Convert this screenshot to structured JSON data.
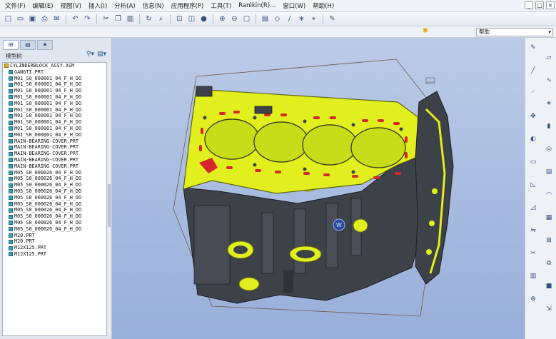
{
  "menubar": {
    "items": [
      "文件(F)",
      "编辑(E)",
      "视图(V)",
      "插入(I)",
      "分析(A)",
      "信息(N)",
      "应用程序(P)",
      "工具(T)",
      "Ranlkin(R)...",
      "窗口(W)",
      "帮助(H)"
    ]
  },
  "window_controls": [
    "_",
    "□",
    "×"
  ],
  "toolbar_icons": [
    "new-icon",
    "open-icon",
    "save-icon",
    "print-icon",
    "email-icon",
    "sep",
    "undo-icon",
    "redo-icon",
    "sep",
    "cut-icon",
    "copy-icon",
    "paste-icon",
    "sep",
    "regenerate-icon",
    "find-icon",
    "sep",
    "orient-icon",
    "saved-views-icon",
    "shading-icon",
    "sep",
    "zoom-in-icon",
    "zoom-out-icon",
    "refit-icon",
    "sep",
    "layer-icon",
    "datum-plane-icon",
    "datum-axis-icon",
    "datum-point-icon",
    "csys-icon",
    "sep",
    "annotation-icon"
  ],
  "help_box": {
    "value": "帮助"
  },
  "panel": {
    "tabs": [
      "model-tree-tab",
      "folder-tab",
      "favorites-tab"
    ],
    "title": "模型树"
  },
  "tree": {
    "root": "CYLINDERBLOCK_ASSY.ASM",
    "children": [
      "GANGTI.PRT",
      "M01_S0_000001_04_F_H_DO",
      "M01_S0_000001_04_F_H_DO",
      "M01_S0_000001_04_F_H_DO",
      "M01_S0_000001_04_F_H_DO",
      "M01_S0_000001_04_F_H_DO",
      "M01_S0_000001_04_F_H_DO",
      "M01_S0_000001_04_F_H_DO",
      "M01_S0_000001_04_F_H_DO",
      "M01_S0_000001_04_F_H_DO",
      "M01_S0_000001_04_F_H_DO",
      "MAIN-BEARING-COVER.PRT",
      "MAIN-BEARING-COVER.PRT",
      "MAIN-BEARING-COVER.PRT",
      "MAIN-BEARING-COVER.PRT",
      "MAIN-BEARING-COVER.PRT",
      "M05_S0_000026_04_F_H_DO",
      "M05_S0_000026_04_F_H_DO",
      "M05_S0_000026_04_F_H_DO",
      "M05_S0_000026_04_F_H_DO",
      "M05_S0_000026_04_F_H_DO",
      "M05_S0_000026_04_F_H_DO",
      "M05_S0_000026_04_F_H_DO",
      "M05_S0_000026_04_F_H_DO",
      "M05_S0_000026_04_F_H_DO",
      "M05_S0_000026_04_F_H_DO",
      "M20.PRT",
      "M20.PRT",
      "M12X125.PRT",
      "M12X125.PRT"
    ]
  },
  "right_toolbar_icons": [
    "sketch-icon",
    "plane-icon",
    "line-icon",
    "spline-icon",
    "fillet-icon",
    "point-icon",
    "move-icon",
    "extrude-icon",
    "revolve-icon",
    "hole-icon",
    "shell-icon",
    "rib-icon",
    "draft-icon",
    "round-icon",
    "chamfer-icon",
    "pattern-icon",
    "mirror-icon",
    "merge-icon",
    "trim-icon",
    "offset-icon",
    "thicken-icon",
    "solidify-icon",
    "intersect-icon",
    "project-icon"
  ],
  "colors": {
    "model_highlight": "#e2ef1e",
    "model_body": "#3d4148",
    "cylinder_bore": "#c9dc1a",
    "gasket_red": "#d6282c",
    "viewport_bg": "#a9bde1"
  }
}
